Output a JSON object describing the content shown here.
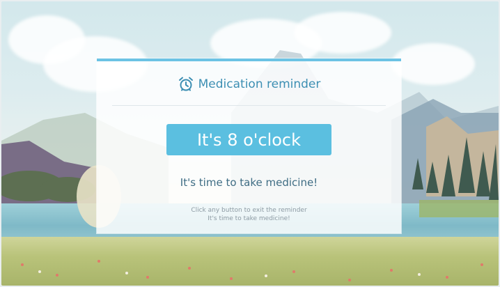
{
  "dialog": {
    "icon": "alarm-clock-icon",
    "title": "Medication reminder",
    "time_label": "It's 8 o'clock",
    "message": "It's time to take medicine!",
    "hint_line1": "Click any button to exit the reminder",
    "hint_line2": "It's time to take medicine!"
  },
  "colors": {
    "accent": "#5bbfe0",
    "title_text": "#3d8fb3",
    "message_text": "#3f6d84",
    "hint_text": "#8c9aa3"
  }
}
